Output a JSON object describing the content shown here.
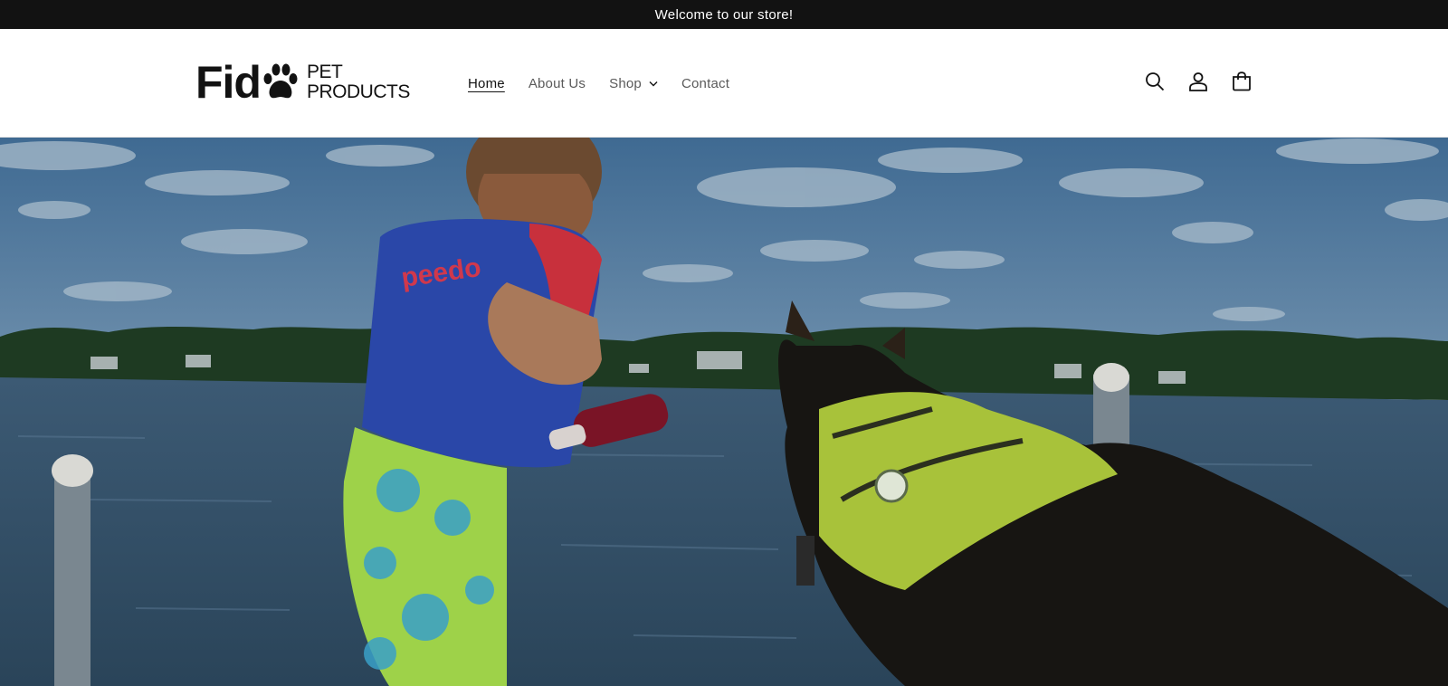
{
  "announcement": {
    "text": "Welcome to our store!"
  },
  "logo": {
    "main": "Fid",
    "line1": "PET",
    "line2": "PRODUCTS"
  },
  "nav": {
    "items": [
      {
        "label": "Home",
        "active": true
      },
      {
        "label": "About Us",
        "active": false
      },
      {
        "label": "Shop",
        "active": false,
        "has_dropdown": true
      },
      {
        "label": "Contact",
        "active": false
      }
    ]
  },
  "header_icons": [
    "search-icon",
    "account-icon",
    "cart-icon"
  ],
  "hero": {
    "image": "boy-and-dog-with-life-jackets-on-dock-at-lake",
    "vest_text": "peedo"
  },
  "colors": {
    "announcement_bg": "#121212",
    "text": "#121212",
    "nav_muted": "#5a5a5a"
  }
}
